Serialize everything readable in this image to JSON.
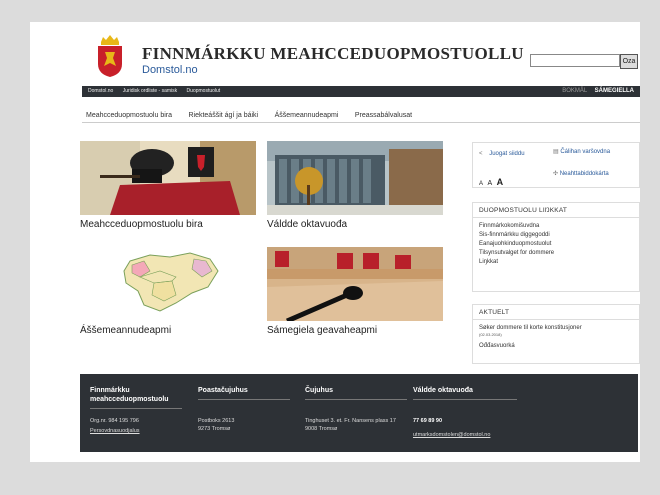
{
  "header": {
    "title": "FINNMÁRKKU MEAHCCEDUOPMOSTUOLLU",
    "subtitle": "Domstol.no",
    "search": {
      "placeholder": "",
      "button_label": "Oza"
    }
  },
  "topbar": {
    "links": [
      "Domstol.no",
      "Juridisk ordliste - samisk",
      "Duopmostuolut"
    ],
    "languages": {
      "inactive": "BOKMÅL",
      "active": "SÁMEGIELLA"
    }
  },
  "main_nav": [
    "Meahcceduopmostuolu bira",
    "Riekteáššit ágí ja báiki",
    "Áššemeannudeapmi",
    "Preassabálvalusat"
  ],
  "tiles": [
    {
      "caption": "Meahcceduopmostuolu bira"
    },
    {
      "caption": "Váldde oktavuođa"
    },
    {
      "caption": "Áššemeannudeapmi"
    },
    {
      "caption": "Sámegiela geavaheapmi"
    }
  ],
  "tools": {
    "share": "Juogat siiddu",
    "print": "Čálihan varšovdna",
    "font_sizes": [
      "A",
      "A",
      "A"
    ],
    "sitemap": "Neahttabiddokárta"
  },
  "links_box": {
    "title": "DUOPMOSTUOLU LIŊKKAT",
    "items": [
      "Finnmárkokomišuvdna",
      "Sis-finnmárkku diggegoddi",
      "Eanajuohkinduopmostuolut",
      "Tilsynsutvalget for dommere",
      "Liŋkkat"
    ]
  },
  "news_box": {
    "title": "AKTUELT",
    "headline": "Søker dommere til korte konstitusjoner",
    "date": "(02.03.2018)",
    "more": "Ođđasvuorká"
  },
  "footer": {
    "col1": {
      "title": "Finnmárkku meahcceduopmostuolu",
      "org": "Org.nr. 984 195 796",
      "link": "Persovdnasuodjalus"
    },
    "col2": {
      "title": "Poastačujuhus",
      "line1": "Postboks 2613",
      "line2": "9273 Tromsø"
    },
    "col3": {
      "title": "Čujuhus",
      "line1": "Tinghuset 3. et. Fr. Nansens plass 17",
      "line2": "9008 Tromsø"
    },
    "col4": {
      "title": "Váldde oktavuođa",
      "phone": "77 69 89 90",
      "email": "utmarksdomstolen@domstol.no"
    }
  },
  "colors": {
    "dark_bar": "#2d3136",
    "crest_red": "#c8202a",
    "crest_gold": "#e8b818",
    "link_blue": "#2a5a9a"
  }
}
